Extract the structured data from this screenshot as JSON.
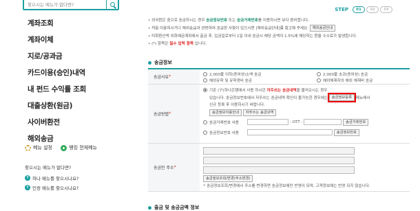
{
  "sidebar": {
    "search_placeholder": "찾으시는 메뉴가 없다면?",
    "menu": [
      "계좌조회",
      "계좌이체",
      "지로/공과금",
      "카드이용(승인)내역",
      "내 펀드 수익률 조회",
      "대출상환(원금)",
      "사이버환전",
      "해외송금"
    ],
    "menu_settings": "메뉴 설정",
    "all_menu": "뱅킹 전체메뉴",
    "help_title": "찾으시는 메뉴가 없다면?",
    "help_1": "하나 메뉴를 찾으시나요?",
    "help_2": "인정 메뉴를 찾으시나요?"
  },
  "steps": {
    "label": "STEP",
    "items": [
      "01",
      "02",
      "03"
    ]
  },
  "notes": {
    "n1a": "외국환은 중으로 송금하시는 경우",
    "n1b": "송금정보번호",
    "n1c": "또는",
    "n1d": "송금거래번호",
    "n1e": "를 이용하시면 보다 편리합니다.",
    "n2a": "처음 이용하시거나 해외송금과 관련하여 궁금한 사항이 있으시면 [해외송금안내]를 참고해 주세요.",
    "n2btn": "해외송금안내",
    "n3": "미화환산액 외화예금계좌에서 출금 후, 입금일로부터 1일 이내 송금시 해당 금액의 1.5%에 해당하는 환율 수수료가 발생합니다.",
    "n4a": "(*) 항목은",
    "n4b": "필수 입력 항목",
    "n4c": "입니다."
  },
  "section1_title": "송금정보",
  "form": {
    "amount_label": "송금사유",
    "amount_opts": [
      "2,000불 이하(증여성)소액 송금",
      "2,000불 초과(증여성) 송금",
      "해외유학 및 유학경비 송금",
      "해외체재자의 해외 체재비 송금"
    ],
    "method_label": "송금방법",
    "method_note_a": "기존 (구)하나은행에서 사용 하시던",
    "method_note_b": "자주쓰는 송금내역",
    "method_note_c": "을 불러오시는 경우",
    "method_note_d": "있습니다. 송금정보번호에서 자주쓰는 송금내역 확인이 불가능한 경우에는",
    "method_note_btn": "송금정보등록",
    "method_note_e": "메뉴에서",
    "method_note_f": "신규 등록 후 이용하시기 바랍니다.",
    "btn_info": "송금정보이용안내",
    "btn_freq": "자주쓰는 송금내역",
    "opt_trade": "송금거래번호 사용",
    "otp": "- OTT -",
    "btn_trade": "송금거래번호",
    "opt_info": "송금정보번호 사용",
    "btn_info_no": "송금정보번호",
    "addr_label": "송금인 주소",
    "btn_addr": "송금정보조회/변경(주소변경)",
    "addr_note": "송금정보조회/변경에서 주소를 변경하면 송금정보에만 반영이 되며, 고객정보에는 반영 되지 않습니다."
  },
  "section2_title": "출금 및 송금금액 정보",
  "colors": {
    "accent": "#1a9fa0",
    "required": "#dd2222"
  }
}
